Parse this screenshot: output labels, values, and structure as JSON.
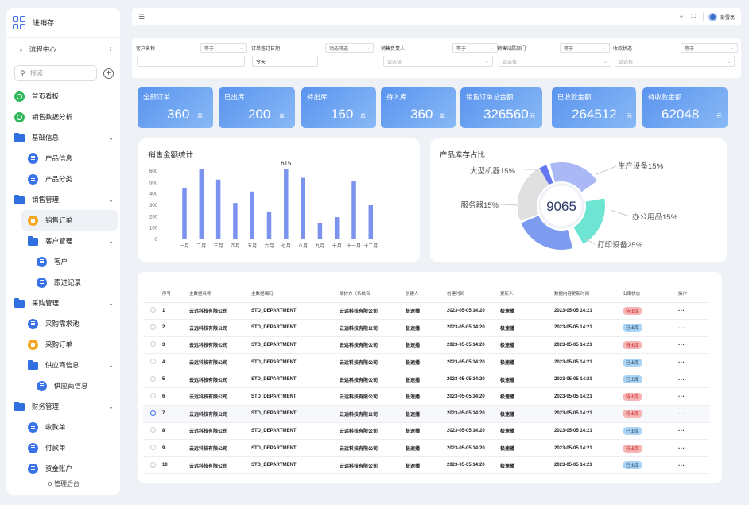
{
  "app": {
    "title": "进销存"
  },
  "sidebar": {
    "flow_center": "流程中心",
    "search_placeholder": "搜索",
    "items": [
      {
        "label": "首页看板",
        "icon": "dashboard-icon",
        "type": "green",
        "level": 1
      },
      {
        "label": "销售数据分析",
        "icon": "analysis-icon",
        "type": "green",
        "level": 1
      },
      {
        "label": "基础信息",
        "icon": "folder-icon",
        "type": "folder",
        "level": 1,
        "chev": "⌄"
      },
      {
        "label": "产品信息",
        "icon": "doc-icon",
        "type": "doc",
        "level": 2
      },
      {
        "label": "产品分类",
        "icon": "doc-icon",
        "type": "doc",
        "level": 2
      },
      {
        "label": "销售管理",
        "icon": "folder-icon",
        "type": "folder",
        "level": 1,
        "chev": "⌄"
      },
      {
        "label": "销售订单",
        "icon": "order-icon",
        "type": "orange",
        "level": 2,
        "active": true
      },
      {
        "label": "客户管理",
        "icon": "folder-icon",
        "type": "folder",
        "level": 2,
        "chev": "⌄"
      },
      {
        "label": "客户",
        "icon": "doc-icon",
        "type": "doc",
        "level": 3
      },
      {
        "label": "跟进记录",
        "icon": "doc-icon",
        "type": "doc",
        "level": 3
      },
      {
        "label": "采购管理",
        "icon": "folder-icon",
        "type": "folder",
        "level": 1,
        "chev": "⌄"
      },
      {
        "label": "采购需求池",
        "icon": "doc-icon",
        "type": "doc",
        "level": 2
      },
      {
        "label": "采购订单",
        "icon": "order-icon",
        "type": "orange",
        "level": 2
      },
      {
        "label": "供应商信息",
        "icon": "folder-icon",
        "type": "folder",
        "level": 2,
        "chev": "⌄"
      },
      {
        "label": "供应商信息",
        "icon": "doc-icon",
        "type": "doc",
        "level": 3
      },
      {
        "label": "财务管理",
        "icon": "folder-icon",
        "type": "folder",
        "level": 1,
        "chev": "⌄"
      },
      {
        "label": "收款单",
        "icon": "doc-icon",
        "type": "doc",
        "level": 2
      },
      {
        "label": "付款单",
        "icon": "doc-icon",
        "type": "doc",
        "level": 2
      },
      {
        "label": "资金账户",
        "icon": "doc-icon",
        "type": "doc",
        "level": 2
      }
    ],
    "admin": "管理后台"
  },
  "topbar": {
    "user_name": "彭雪亮"
  },
  "filters": [
    {
      "label": "客户名称",
      "op": "等于",
      "value": ""
    },
    {
      "label": "订单签订日期",
      "op": "动态筛选",
      "value": "今天"
    },
    {
      "label": "销售负责人",
      "op": "等于",
      "value": "请选择"
    },
    {
      "label": "销售归属部门",
      "op": "等于",
      "value": "请选择"
    },
    {
      "label": "收款状态",
      "op": "等于",
      "value": "请选择"
    }
  ],
  "stats": [
    {
      "title": "全部订单",
      "value": "360",
      "unit": "单"
    },
    {
      "title": "已出库",
      "value": "200",
      "unit": "单"
    },
    {
      "title": "待出库",
      "value": "160",
      "unit": "单"
    },
    {
      "title": "待入库",
      "value": "360",
      "unit": "单"
    },
    {
      "title": "销售订单总金额",
      "value": "326560",
      "unit": "元"
    },
    {
      "title": "已收款金额",
      "value": "264512",
      "unit": "元"
    },
    {
      "title": "待收款金额",
      "value": "62048",
      "unit": "元"
    }
  ],
  "chart_data": [
    {
      "type": "bar",
      "title": "销售金额统计",
      "categories": [
        "一月",
        "二月",
        "三月",
        "四月",
        "五月",
        "六月",
        "七月",
        "八月",
        "九月",
        "十月",
        "十一月",
        "十二月"
      ],
      "values": [
        450,
        615,
        525,
        320,
        420,
        245,
        615,
        540,
        145,
        195,
        515,
        300
      ],
      "data_labels": {
        "6": "615"
      },
      "ylim": [
        0,
        600
      ],
      "yticks": [
        0,
        100,
        200,
        300,
        400,
        500,
        600
      ],
      "color": "#7b93ef"
    },
    {
      "type": "pie",
      "title": "产品库存占比",
      "center_value": "9065",
      "slices": [
        {
          "label": "大型机器",
          "pct": 15,
          "color": "#6576ee"
        },
        {
          "label": "生产设备",
          "pct": 15,
          "color": "#aab9f5"
        },
        {
          "label": "办公用品",
          "pct": 15,
          "color": "#6de5d2"
        },
        {
          "label": "打印设备",
          "pct": 25,
          "color": "#7e9cef"
        },
        {
          "label": "服务器",
          "pct": 15,
          "color": "#e0e0e0"
        }
      ]
    }
  ],
  "table": {
    "headers": [
      "",
      "序号",
      "主数据名称",
      "主数据编码",
      "维护方（系统名）",
      "创建人",
      "创建时间",
      "更新人",
      "数据内容更新时间",
      "出库状态",
      "操作"
    ],
    "rows": [
      {
        "no": "1",
        "name": "云远科技有限公司",
        "code": "STD_DEPARTMENT",
        "owner": "云远科技有限公司",
        "creator": "极速播",
        "ctime": "2023-05-05 14:20",
        "updater": "极速播",
        "utime": "2023-05-05 14:21",
        "status": "待出库",
        "status_type": "red"
      },
      {
        "no": "2",
        "name": "云远科技有限公司",
        "code": "STD_DEPARTMENT",
        "owner": "云远科技有限公司",
        "creator": "极速播",
        "ctime": "2023-05-05 14:20",
        "updater": "极速播",
        "utime": "2023-05-05 14:21",
        "status": "已出库",
        "status_type": "blue"
      },
      {
        "no": "3",
        "name": "云远科技有限公司",
        "code": "STD_DEPARTMENT",
        "owner": "云远科技有限公司",
        "creator": "极速播",
        "ctime": "2023-05-05 14:20",
        "updater": "极速播",
        "utime": "2023-05-05 14:21",
        "status": "待出库",
        "status_type": "red"
      },
      {
        "no": "4",
        "name": "云远科技有限公司",
        "code": "STD_DEPARTMENT",
        "owner": "云远科技有限公司",
        "creator": "极速播",
        "ctime": "2023-05-05 14:20",
        "updater": "极速播",
        "utime": "2023-05-05 14:21",
        "status": "已出库",
        "status_type": "blue"
      },
      {
        "no": "5",
        "name": "云远科技有限公司",
        "code": "STD_DEPARTMENT",
        "owner": "云远科技有限公司",
        "creator": "极速播",
        "ctime": "2023-05-05 14:20",
        "updater": "极速播",
        "utime": "2023-05-05 14:21",
        "status": "已出库",
        "status_type": "blue"
      },
      {
        "no": "6",
        "name": "云远科技有限公司",
        "code": "STD_DEPARTMENT",
        "owner": "云远科技有限公司",
        "creator": "极速播",
        "ctime": "2023-05-05 14:20",
        "updater": "极速播",
        "utime": "2023-05-05 14:21",
        "status": "待出库",
        "status_type": "red"
      },
      {
        "no": "7",
        "name": "云远科技有限公司",
        "code": "STD_DEPARTMENT",
        "owner": "云远科技有限公司",
        "creator": "极速播",
        "ctime": "2023-05-05 14:20",
        "updater": "极速播",
        "utime": "2023-05-05 14:21",
        "status": "待出库",
        "status_type": "red",
        "selected": true
      },
      {
        "no": "8",
        "name": "云远科技有限公司",
        "code": "STD_DEPARTMENT",
        "owner": "云远科技有限公司",
        "creator": "极速播",
        "ctime": "2023-05-05 14:20",
        "updater": "极速播",
        "utime": "2023-05-05 14:21",
        "status": "已出库",
        "status_type": "blue"
      },
      {
        "no": "9",
        "name": "云远科技有限公司",
        "code": "STD_DEPARTMENT",
        "owner": "云远科技有限公司",
        "creator": "极速播",
        "ctime": "2023-05-05 14:20",
        "updater": "极速播",
        "utime": "2023-05-05 14:21",
        "status": "待出库",
        "status_type": "red"
      },
      {
        "no": "10",
        "name": "云远科技有限公司",
        "code": "STD_DEPARTMENT",
        "owner": "云远科技有限公司",
        "creator": "极速播",
        "ctime": "2023-05-05 14:20",
        "updater": "极速播",
        "utime": "2023-05-05 14:21",
        "status": "已出库",
        "status_type": "blue"
      }
    ]
  }
}
